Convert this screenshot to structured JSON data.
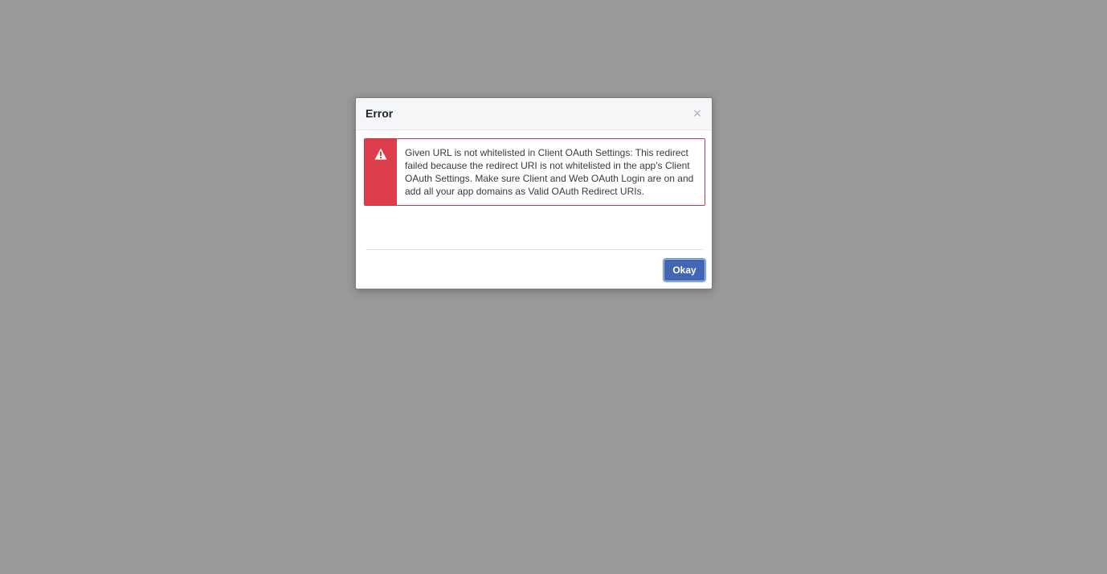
{
  "dialog": {
    "title": "Error",
    "close_symbol": "×",
    "close_icon": "close-icon",
    "alert": {
      "icon": "warning-triangle-icon",
      "color": "#dd3c4b",
      "message": "Given URL is not whitelisted in Client OAuth Settings: This redirect failed because the redirect URI is not whitelisted in the app’s Client OAuth Settings. Make sure Client and Web OAuth Login are on and add all your app domains as Valid OAuth Redirect URIs."
    },
    "okay_label": "Okay",
    "accent_color": "#4267b2"
  }
}
